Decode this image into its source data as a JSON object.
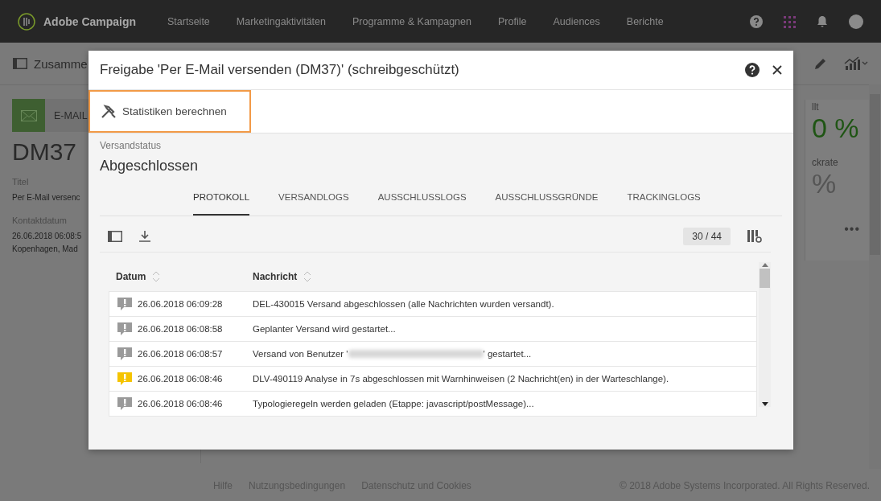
{
  "app": {
    "name": "Adobe Campaign"
  },
  "nav": {
    "items": [
      {
        "label": "Startseite",
        "selected": false
      },
      {
        "label": "Marketingaktivitäten",
        "selected": false
      },
      {
        "label": "Programme & Kampagnen",
        "selected": false
      },
      {
        "label": "Profile",
        "selected": false
      },
      {
        "label": "Audiences",
        "selected": false
      },
      {
        "label": "Berichte",
        "selected": false
      }
    ]
  },
  "page": {
    "title": "Zusamme",
    "channel": "E-MAIL",
    "label": "DM37",
    "fields": [
      {
        "label": "Titel",
        "lines": [
          "Per E-Mail versenc"
        ]
      },
      {
        "label": "Kontaktdatum",
        "lines": [
          "26.06.2018 06:08:5",
          "Kopenhagen, Mad"
        ]
      }
    ],
    "stats": [
      {
        "label": "llt",
        "value": "0 %",
        "kind": "accent"
      },
      {
        "label": "ckrate",
        "value": "%",
        "kind": "plain"
      }
    ],
    "more": "•••"
  },
  "footer": {
    "links": [
      "Hilfe",
      "Nutzungsbedingungen",
      "Datenschutz und Cookies"
    ],
    "copyright": "© 2018 Adobe Systems Incorporated. All Rights Reserved."
  },
  "dialog": {
    "title": "Freigabe 'Per E-Mail versenden (DM37)' (schreibgeschützt)",
    "action": "Statistiken berechnen",
    "status_label": "Versandstatus",
    "status": "Abgeschlossen",
    "tabs": [
      {
        "label": "PROTOKOLL",
        "selected": true
      },
      {
        "label": "VERSANDLOGS",
        "selected": false
      },
      {
        "label": "AUSSCHLUSSLOGS",
        "selected": false
      },
      {
        "label": "AUSSCHLUSSGRÜNDE",
        "selected": false
      },
      {
        "label": "TRACKINGLOGS",
        "selected": false
      }
    ],
    "count": "30 / 44",
    "table": {
      "columns": [
        "Datum",
        "Nachricht"
      ],
      "rows": [
        {
          "kind": "info",
          "date": "26.06.2018 06:09:28",
          "message": "DEL-430015 Versand abgeschlossen (alle Nachrichten wurden versandt)."
        },
        {
          "kind": "info",
          "date": "26.06.2018 06:08:58",
          "message": "Geplanter Versand wird gestartet..."
        },
        {
          "kind": "info",
          "date": "26.06.2018 06:08:57",
          "message": "Versand von Benutzer '",
          "redacted": true,
          "message_end": "' gestartet..."
        },
        {
          "kind": "warning",
          "date": "26.06.2018 06:08:46",
          "message": "DLV-490119 Analyse in 7s abgeschlossen mit Warnhinweisen (2 Nachricht(en) in der Warteschlange)."
        },
        {
          "kind": "info",
          "date": "26.06.2018 06:08:46",
          "message": "Typologieregeln werden geladen (Etappe: javascript/postMessage)..."
        }
      ]
    }
  }
}
